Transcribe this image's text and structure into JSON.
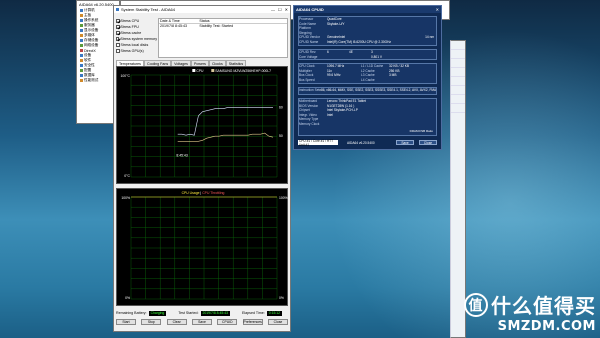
{
  "aida_main": {
    "title": "AIDA64 v6.20.5400",
    "tree": [
      {
        "label": "计算机",
        "c": ""
      },
      {
        "label": "主板",
        "c": "o"
      },
      {
        "label": "操作系统",
        "c": ""
      },
      {
        "label": "服务器",
        "c": "g"
      },
      {
        "label": "显示设备",
        "c": ""
      },
      {
        "label": "多媒体",
        "c": "o"
      },
      {
        "label": "存储设备",
        "c": ""
      },
      {
        "label": "网络设备",
        "c": "g"
      },
      {
        "label": "DirectX",
        "c": "r"
      },
      {
        "label": "设备",
        "c": ""
      },
      {
        "label": "软件",
        "c": "o"
      },
      {
        "label": "安全性",
        "c": ""
      },
      {
        "label": "配置",
        "c": "g"
      },
      {
        "label": "数据库",
        "c": ""
      },
      {
        "label": "性能测试",
        "c": "o"
      }
    ]
  },
  "stability": {
    "title": "System Stability Test - AIDA64",
    "options": [
      {
        "label": "Stress CPU",
        "on": true
      },
      {
        "label": "Stress FPU",
        "on": true
      },
      {
        "label": "Stress cache",
        "on": true
      },
      {
        "label": "Stress system memory",
        "on": true
      },
      {
        "label": "Stress local disks",
        "on": false
      },
      {
        "label": "Stress GPU(s)",
        "on": false
      }
    ],
    "status_table": {
      "headers": [
        "Date & Time",
        "Status"
      ],
      "rows": [
        [
          "2019/7/8 8:45:43",
          "Stability Test: Started"
        ]
      ]
    },
    "tabs": [
      "Temperatures",
      "Cooling Fans",
      "Voltages",
      "Powers",
      "Clocks",
      "Statistics"
    ],
    "graph1": {
      "legend_cpu": "CPU",
      "legend_disk": "SAMSUNG MZVLW256HEHP-000L7",
      "y_top": "100°C",
      "y_bottom": "0°C",
      "right_top": "60",
      "right_bottom": "50",
      "time": "8:45:43"
    },
    "graph2": {
      "title": "CPU Usage",
      "sep": " | ",
      "throttle": "CPU Throttling",
      "y_top": "100%",
      "y_bottom": "0%",
      "right_top": "100%",
      "right_bottom": "0%"
    },
    "bottom": {
      "battery_label": "Remaining Battery:",
      "battery_value": "Charging",
      "started_label": "Test Started:",
      "started_value": "2019/7/8 8:45:43",
      "elapsed_label": "Elapsed Time:",
      "elapsed_value": "0:15:12"
    },
    "buttons": [
      "Start",
      "Stop",
      "Clear",
      "Save",
      "CPUID",
      "Preferences",
      "Close"
    ]
  },
  "cpuid": {
    "title": "AIDA64 CPUID",
    "rows1": [
      [
        "Processor",
        "QuadCore"
      ],
      [
        "Code Name",
        "Skylake-U/Y"
      ],
      [
        "Platform",
        ""
      ],
      [
        "Stepping",
        ""
      ],
      [
        "CPUID Vendor",
        "GenuineIntel"
      ],
      [
        "CPUID Name",
        "Intel(R) Core(TM) i5-6200U CPU @ 2.30GHz"
      ]
    ],
    "nm": "14 nm",
    "row_rev": [
      [
        "CPUID Rev.",
        "6",
        "4E",
        "3"
      ],
      [
        "Core Voltage",
        "",
        "",
        "0.801 V"
      ]
    ],
    "clocks": [
      [
        "CPU Clock",
        "1096.7 MHz",
        "L1 / L1D Cache",
        "32 KB / 32 KB"
      ],
      [
        "Multiplier",
        "11x",
        "L2 Cache",
        "256 KB"
      ],
      [
        "Bus Clock",
        "99.6 MHz",
        "L3 Cache",
        "3 MB"
      ],
      [
        "Bus Speed",
        "",
        "L4 Cache",
        ""
      ]
    ],
    "iset": [
      "Instruction Set",
      "x86, x86-64, MMX, SSE, SSE2, SSE3, SSSE3, SSE4.1, SSE4.2, AVX, AVX2, FMA"
    ],
    "board": [
      [
        "Motherboard",
        "Lenovo ThinkPad E1 Tablet"
      ],
      [
        "BIOS Version",
        "N1GET28W (1.16 )"
      ],
      [
        "Chipset",
        "Intel Skylake-PCH-LP"
      ],
      [
        "Integr. Video",
        "Intel"
      ],
      [
        "Memory Type",
        ""
      ],
      [
        "Memory Clock",
        ""
      ]
    ],
    "dram": "DRAM:FSB Ratio",
    "foot": {
      "select": "CPU #1 / Core #1 / HTT Unit #1",
      "version": "AIDA64 v6.20.5400",
      "save": "Save",
      "close": "Close"
    }
  },
  "watermark": {
    "main": "什么值得买",
    "url": "SMZDM.COM",
    "logo": "值"
  },
  "chart_data": [
    {
      "type": "line",
      "title": "",
      "ylabel": "°C",
      "ylim": [
        0,
        100
      ],
      "series": [
        {
          "name": "CPU",
          "values": [
            42,
            42,
            41,
            42,
            41,
            60,
            64,
            65,
            66,
            67,
            67,
            67,
            68,
            68,
            68,
            68,
            68,
            68,
            68,
            68,
            68,
            68,
            68,
            68
          ]
        },
        {
          "name": "SAMSUNG MZVLW256HEHP-000L7",
          "values": [
            35,
            35,
            35,
            35,
            35,
            35,
            36,
            38,
            39,
            40,
            40,
            41,
            41,
            41,
            41,
            41,
            41,
            41,
            42,
            42,
            42,
            43,
            40,
            39
          ]
        }
      ]
    },
    {
      "type": "line",
      "title": "CPU Usage",
      "ylabel": "%",
      "ylim": [
        0,
        100
      ],
      "series": [
        {
          "name": "CPU Usage",
          "values": [
            100,
            100,
            100,
            100,
            100,
            100,
            100,
            100,
            100,
            100
          ]
        }
      ]
    }
  ]
}
